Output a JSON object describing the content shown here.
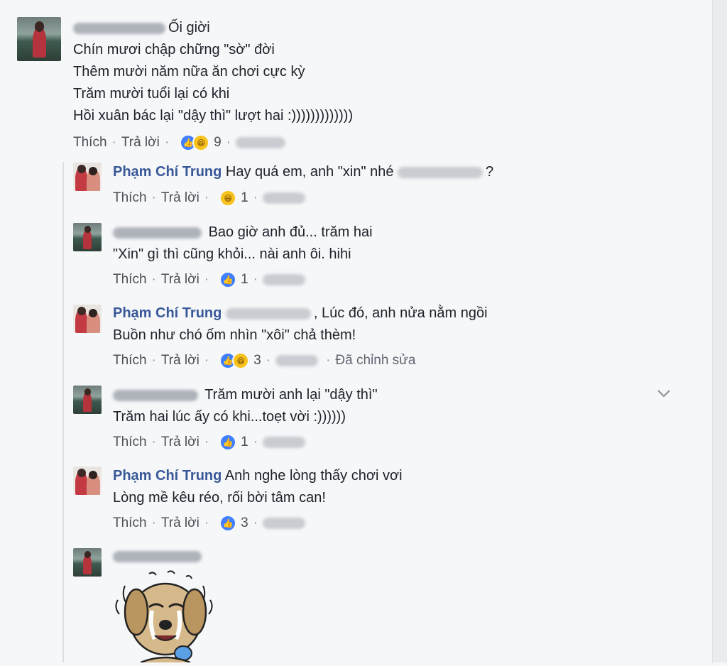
{
  "comments": [
    {
      "author": "",
      "lines": [
        "Ối giời",
        "Chín mươi chập chững \"sờ\" đời",
        "Thêm mười năm nữa ăn chơi cực kỳ",
        "Trăm mười tuổi lại có khi",
        "Hồi xuân bác lại \"dậy thì\" lượt hai :)))))))))))))"
      ],
      "actions": {
        "like": "Thích",
        "reply": "Trả lời",
        "count": "9"
      }
    }
  ],
  "replies": [
    {
      "author": "Phạm Chí Trung",
      "lines": [
        "Hay quá em, anh \"xin\" nhé",
        "?"
      ],
      "actions": {
        "like": "Thích",
        "reply": "Trả lời",
        "count": "1"
      }
    },
    {
      "author": "",
      "lines": [
        "Bao giờ anh đủ... trăm hai",
        "\"Xin\" gì thì cũng khỏi... nài anh ôi. hihi"
      ],
      "actions": {
        "like": "Thích",
        "reply": "Trả lời",
        "count": "1"
      }
    },
    {
      "author": "Phạm Chí Trung",
      "lines": [
        ", Lúc đó, anh nửa nằm ngồi",
        "Buồn như chó ốm nhìn \"xôi\" chả thèm!"
      ],
      "actions": {
        "like": "Thích",
        "reply": "Trả lời",
        "count": "3",
        "edited": "Đã chỉnh sửa"
      }
    },
    {
      "author": "",
      "lines": [
        "Trăm mười anh lại \"dậy thì\"",
        "Trăm hai lúc ấy có khi...toẹt vời :))))))"
      ],
      "actions": {
        "like": "Thích",
        "reply": "Trả lời",
        "count": "1"
      }
    },
    {
      "author": "Phạm Chí Trung",
      "lines": [
        "Anh nghe lòng thấy chơi vơi",
        "Lòng mề kêu réo, rối bời tâm can!"
      ],
      "actions": {
        "like": "Thích",
        "reply": "Trả lời",
        "count": "3"
      }
    }
  ],
  "separator": "·",
  "icons": {
    "like": "thumbs-up-icon",
    "haha": "laughing-face-icon",
    "more": "chevron-down-icon",
    "sticker": "crying-dog-sticker"
  },
  "colors": {
    "author": "#385898",
    "like_blue": "#4080ff",
    "haha_yellow": "#f7c21b"
  }
}
